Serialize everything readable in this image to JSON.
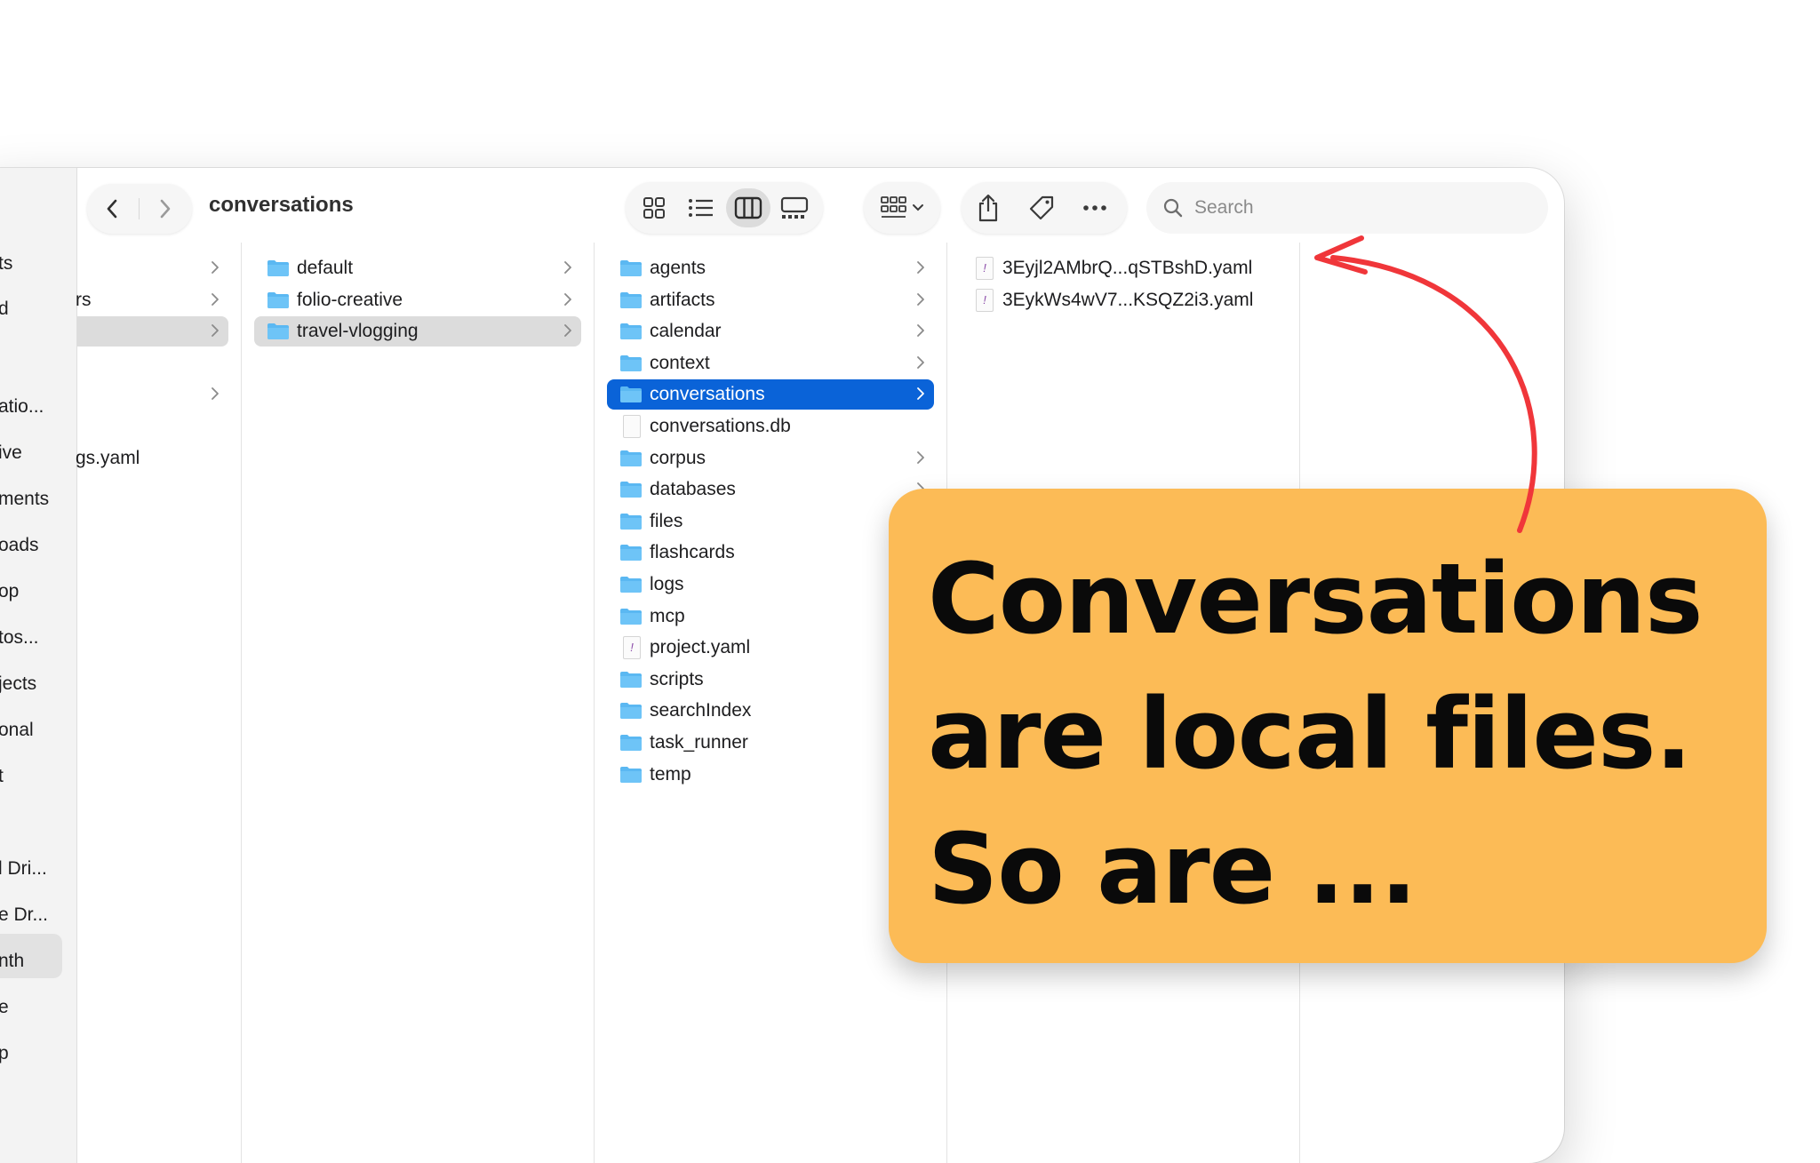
{
  "window": {
    "title": "conversations"
  },
  "toolbar": {
    "back_label": "Back",
    "forward_label": "Forward",
    "search_placeholder": "Search"
  },
  "sidebar": {
    "items": [
      "ts",
      "d",
      "atio...",
      "ive",
      "ments",
      "oads",
      "op",
      "tos...",
      "jects",
      "onal",
      "t",
      "l Dri...",
      "e Dr...",
      "nth",
      "e",
      "p"
    ]
  },
  "column1": {
    "items": [
      {
        "label": "rs",
        "folder": false,
        "chevron": true
      },
      {
        "label": "gs.yaml",
        "folder": false,
        "chevron": false
      }
    ]
  },
  "column2": {
    "items": [
      {
        "label": "default",
        "chevron": true
      },
      {
        "label": "folio-creative",
        "chevron": true
      },
      {
        "label": "travel-vlogging",
        "chevron": true,
        "selected": true
      }
    ]
  },
  "column3": {
    "items": [
      {
        "label": "agents",
        "type": "folder",
        "chevron": true
      },
      {
        "label": "artifacts",
        "type": "folder",
        "chevron": true
      },
      {
        "label": "calendar",
        "type": "folder",
        "chevron": true
      },
      {
        "label": "context",
        "type": "folder",
        "chevron": true
      },
      {
        "label": "conversations",
        "type": "folder",
        "chevron": true,
        "selected": true
      },
      {
        "label": "conversations.db",
        "type": "file",
        "chevron": false
      },
      {
        "label": "corpus",
        "type": "folder",
        "chevron": true
      },
      {
        "label": "databases",
        "type": "folder",
        "chevron": true
      },
      {
        "label": "files",
        "type": "folder",
        "chevron": false
      },
      {
        "label": "flashcards",
        "type": "folder",
        "chevron": false
      },
      {
        "label": "logs",
        "type": "folder",
        "chevron": false
      },
      {
        "label": "mcp",
        "type": "folder",
        "chevron": false
      },
      {
        "label": "project.yaml",
        "type": "yaml",
        "chevron": false
      },
      {
        "label": "scripts",
        "type": "folder",
        "chevron": false
      },
      {
        "label": "searchIndex",
        "type": "folder",
        "chevron": false
      },
      {
        "label": "task_runner",
        "type": "folder",
        "chevron": false
      },
      {
        "label": "temp",
        "type": "folder",
        "chevron": false
      }
    ]
  },
  "column4": {
    "items": [
      {
        "label": "3Eyjl2AMbrQ...qSTBshD.yaml"
      },
      {
        "label": "3EykWs4wV7...KSQZ2i3.yaml"
      }
    ]
  },
  "callout": {
    "lines": [
      "Conversations",
      "are local files.",
      "So are ..."
    ]
  },
  "colors": {
    "accent": "#0a63d8",
    "callout_bg": "#fcbb56",
    "arrow": "#f0363a",
    "folder": "#5bb8f2"
  }
}
